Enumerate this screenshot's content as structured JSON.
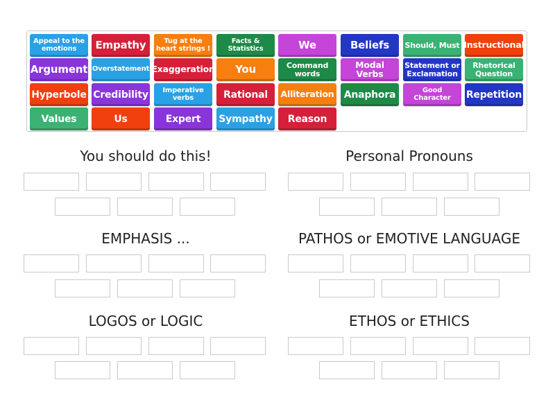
{
  "tiles": [
    {
      "label": "Appeal to the emotions",
      "color": "blue"
    },
    {
      "label": "Empathy",
      "color": "red"
    },
    {
      "label": "Tug at the heart strings !",
      "color": "orange"
    },
    {
      "label": "Facts & Statistics",
      "color": "dgreen"
    },
    {
      "label": "We",
      "color": "magenta"
    },
    {
      "label": "Beliefs",
      "color": "navy"
    },
    {
      "label": "Should, Must",
      "color": "mint"
    },
    {
      "label": "Instructional",
      "color": "vermil"
    },
    {
      "label": "Argument",
      "color": "purple"
    },
    {
      "label": "Overstatement",
      "color": "blue"
    },
    {
      "label": "Exaggeration",
      "color": "red"
    },
    {
      "label": "You",
      "color": "orange"
    },
    {
      "label": "Command words",
      "color": "dgreen"
    },
    {
      "label": "Modal Verbs",
      "color": "magenta"
    },
    {
      "label": "Statement or Exclamation",
      "color": "navy"
    },
    {
      "label": "Rhetorical Question",
      "color": "mint"
    },
    {
      "label": "Hyperbole",
      "color": "vermil"
    },
    {
      "label": "Credibility",
      "color": "purple"
    },
    {
      "label": "Imperative verbs",
      "color": "blue"
    },
    {
      "label": "Rational",
      "color": "red"
    },
    {
      "label": "Alliteration",
      "color": "orange"
    },
    {
      "label": "Anaphora",
      "color": "dgreen"
    },
    {
      "label": "Good Character",
      "color": "magenta"
    },
    {
      "label": "Repetition",
      "color": "navy"
    },
    {
      "label": "Values",
      "color": "mint"
    },
    {
      "label": "Us",
      "color": "vermil"
    },
    {
      "label": "Expert",
      "color": "purple"
    },
    {
      "label": "Sympathy",
      "color": "blue"
    },
    {
      "label": "Reason",
      "color": "red"
    }
  ],
  "colors": {
    "blue": "#2aa1e4",
    "red": "#d6203a",
    "orange": "#f67f10",
    "dgreen": "#1e8a47",
    "magenta": "#c445d8",
    "navy": "#2237c4",
    "mint": "#3bb273",
    "vermil": "#f13f0e",
    "purple": "#8a35d9"
  },
  "groups": [
    {
      "title": "You should do this!",
      "slots": 7
    },
    {
      "title": "Personal Pronouns",
      "slots": 7
    },
    {
      "title": "EMPHASIS ...",
      "slots": 7
    },
    {
      "title": "PATHOS or EMOTIVE LANGUAGE",
      "slots": 7
    },
    {
      "title": "LOGOS or LOGIC",
      "slots": 7
    },
    {
      "title": "ETHOS or ETHICS",
      "slots": 7
    }
  ]
}
